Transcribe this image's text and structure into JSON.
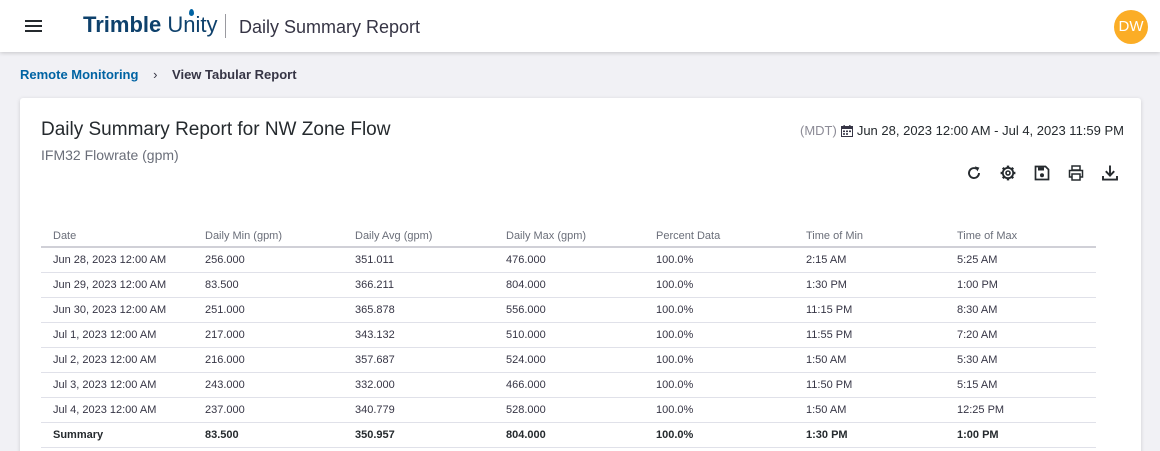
{
  "header": {
    "logo_bold": "Trimble",
    "logo_light": "Unity",
    "app_title": "Daily Summary Report",
    "avatar_initials": "DW"
  },
  "breadcrumb": {
    "parent": "Remote Monitoring",
    "current": "View Tabular Report"
  },
  "report": {
    "title": "Daily Summary Report for NW Zone Flow",
    "subtitle": "IFM32 Flowrate (gpm)",
    "timezone": "(MDT)",
    "date_range": "Jun 28, 2023 12:00 AM - Jul 4, 2023 11:59 PM"
  },
  "toolbar": {
    "icons": [
      "refresh-icon",
      "settings-icon",
      "save-icon",
      "print-icon",
      "download-icon"
    ]
  },
  "table": {
    "columns": [
      "Date",
      "Daily Min (gpm)",
      "Daily Avg (gpm)",
      "Daily Max (gpm)",
      "Percent Data",
      "Time of Min",
      "Time of Max"
    ],
    "rows": [
      [
        "Jun 28, 2023 12:00 AM",
        "256.000",
        "351.011",
        "476.000",
        "100.0%",
        "2:15 AM",
        "5:25 AM"
      ],
      [
        "Jun 29, 2023 12:00 AM",
        "83.500",
        "366.211",
        "804.000",
        "100.0%",
        "1:30 PM",
        "1:00 PM"
      ],
      [
        "Jun 30, 2023 12:00 AM",
        "251.000",
        "365.878",
        "556.000",
        "100.0%",
        "11:15 PM",
        "8:30 AM"
      ],
      [
        "Jul 1, 2023 12:00 AM",
        "217.000",
        "343.132",
        "510.000",
        "100.0%",
        "11:55 PM",
        "7:20 AM"
      ],
      [
        "Jul 2, 2023 12:00 AM",
        "216.000",
        "357.687",
        "524.000",
        "100.0%",
        "1:50 AM",
        "5:30 AM"
      ],
      [
        "Jul 3, 2023 12:00 AM",
        "243.000",
        "332.000",
        "466.000",
        "100.0%",
        "11:50 PM",
        "5:15 AM"
      ],
      [
        "Jul 4, 2023 12:00 AM",
        "237.000",
        "340.779",
        "528.000",
        "100.0%",
        "1:50 AM",
        "12:25 PM"
      ]
    ],
    "summary": [
      "Summary",
      "83.500",
      "350.957",
      "804.000",
      "100.0%",
      "1:30 PM",
      "1:00 PM"
    ]
  }
}
